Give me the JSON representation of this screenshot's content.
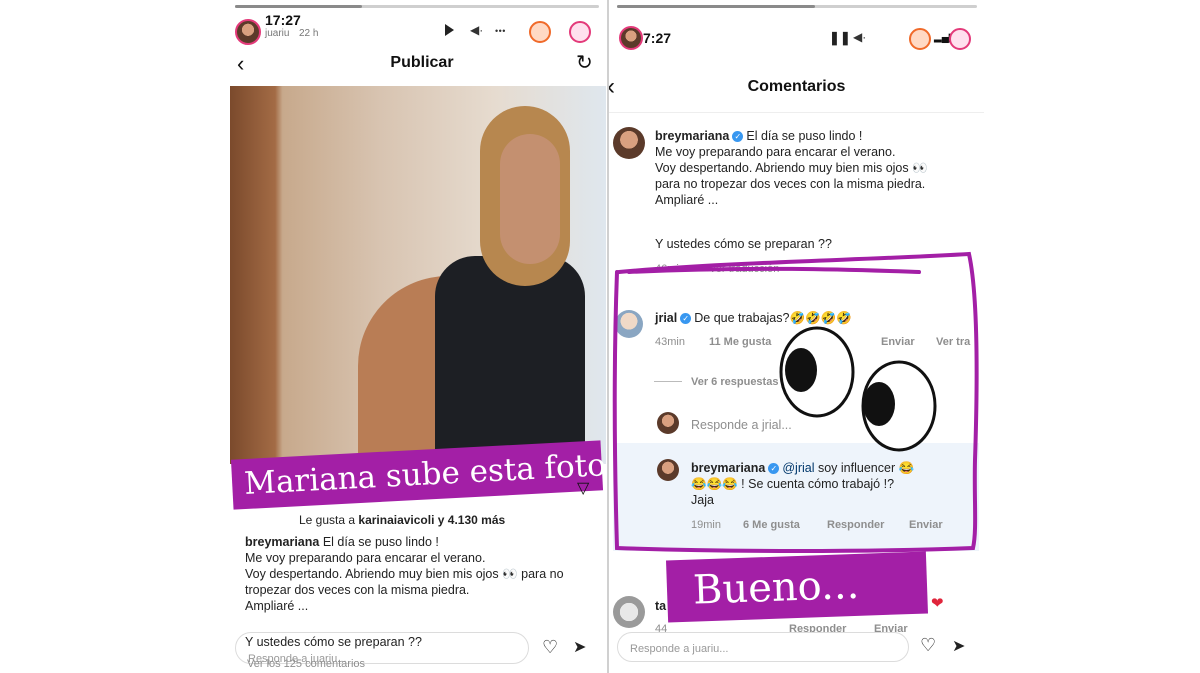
{
  "left": {
    "status_time": "17:27",
    "story_user": "juariu",
    "story_age": "22 h",
    "header_title": "Publicar",
    "liked_by_prefix": "Le gusta a",
    "liked_by_user": "karinaiavicoli",
    "liked_by_suffix": "y 4.130 más",
    "caption_user": "breymariana",
    "caption_lines": [
      "El día se puso lindo !",
      "Me voy preparando para encarar el verano.",
      "Voy despertando. Abriendo muy bien mis ojos 👀 para no",
      "tropezar dos veces con la misma piedra.",
      "Ampliaré ...",
      "Y ustedes cómo se preparan ??"
    ],
    "view_comments": "Ver los 125 comentarios",
    "reply_placeholder": "Responde a juariu...",
    "banner_text": "Mariana sube esta foto"
  },
  "right": {
    "status_time": "7:27",
    "header_title": "Comentarios",
    "post_user": "breymariana",
    "post_lines": [
      "El día se puso lindo !",
      "Me voy preparando para encarar el verano.",
      "Voy despertando. Abriendo muy bien mis ojos 👀",
      "para no tropezar dos veces con la misma piedra.",
      "Ampliaré ..."
    ],
    "post_question": "Y ustedes cómo se preparan ??",
    "post_meta_time": "46min",
    "post_meta_translate": "Ver traducción",
    "comment1": {
      "user": "jrial",
      "text": "De que trabajas?🤣🤣🤣🤣",
      "time": "43min",
      "likes": "11 Me gusta",
      "send": "Enviar",
      "translate": "Ver tra",
      "view_replies": "Ver 6 respuestas"
    },
    "reply_prompt": "Responde a jrial...",
    "reply1": {
      "user": "breymariana",
      "mention": "@jrial",
      "text_line1": "soy influencer 😂",
      "text_line2": "😂😂😂 ! Se cuenta cómo trabajó !?",
      "text_line3": "Jaja",
      "time": "19min",
      "likes": "6 Me gusta",
      "reply": "Responder",
      "send": "Enviar"
    },
    "comment2": {
      "user": "ta",
      "time": "44",
      "reply": "Responder",
      "send": "Enviar"
    },
    "reply_placeholder": "Responde a juariu...",
    "banner_text": "Bueno..."
  },
  "colors": {
    "banner": "#a31fa6",
    "highlight_stroke": "#a31fa6",
    "verified": "#3897f0",
    "heart_red": "#e0243b"
  }
}
